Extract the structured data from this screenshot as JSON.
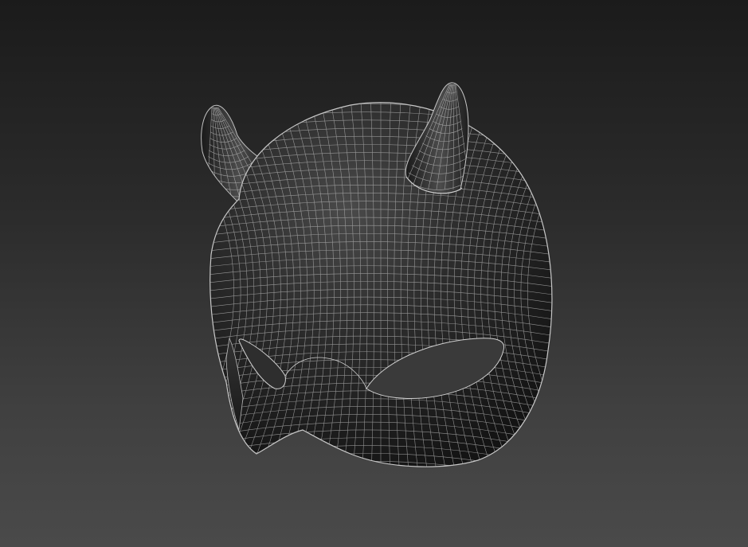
{
  "viewport": {
    "kind": "3d-modeling-viewport",
    "display_mode": "shaded-with-wireframe-edges"
  },
  "model": {
    "object": "devil-mask",
    "features": [
      "left-horn",
      "right-horn",
      "left-eye-hole",
      "right-eye-hole",
      "nose-bridge"
    ]
  },
  "colors": {
    "background_top": "#1b1b1b",
    "background_bottom": "#4a4a4a",
    "surface_dark": "#151515",
    "surface_mid": "#2a2a2a",
    "surface_highlight": "#4a4a4a",
    "wireframe": "#b8b8b8"
  }
}
